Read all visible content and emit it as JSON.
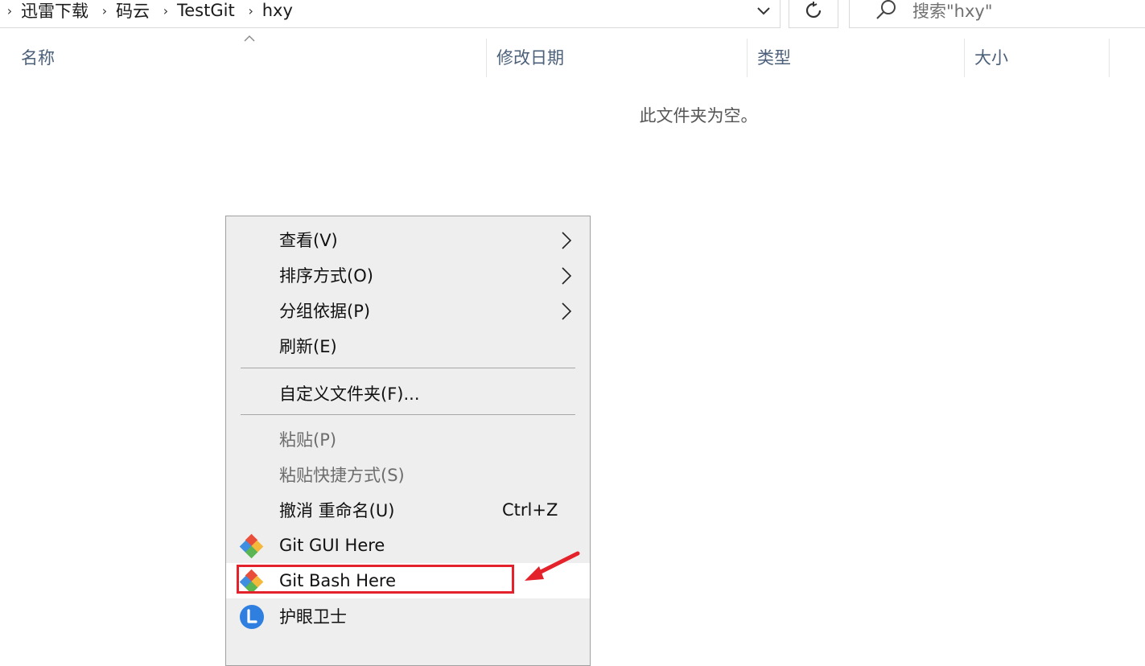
{
  "breadcrumb": {
    "items": [
      "迅雷下载",
      "码云",
      "TestGit",
      "hxy"
    ]
  },
  "search": {
    "placeholder": "搜索\"hxy\""
  },
  "columns": [
    "名称",
    "修改日期",
    "类型",
    "大小"
  ],
  "empty_message": "此文件夹为空。",
  "context_menu": {
    "items": [
      {
        "label": "查看(V)",
        "submenu": true
      },
      {
        "label": "排序方式(O)",
        "submenu": true
      },
      {
        "label": "分组依据(P)",
        "submenu": true
      },
      {
        "label": "刷新(E)"
      },
      {
        "label": "自定义文件夹(F)..."
      },
      {
        "label": "粘贴(P)",
        "disabled": true
      },
      {
        "label": "粘贴快捷方式(S)",
        "disabled": true
      },
      {
        "label": "撤消 重命名(U)",
        "shortcut": "Ctrl+Z"
      },
      {
        "label": "Git GUI Here",
        "icon": "git-icon"
      },
      {
        "label": "Git Bash Here",
        "icon": "git-icon",
        "highlighted": true
      },
      {
        "label": "护眼卫士",
        "icon": "eye-guard-icon"
      }
    ]
  },
  "colors": {
    "annotation": "#e3222b",
    "header_text": "#4c607a",
    "menu_bg": "#eeeeee"
  }
}
